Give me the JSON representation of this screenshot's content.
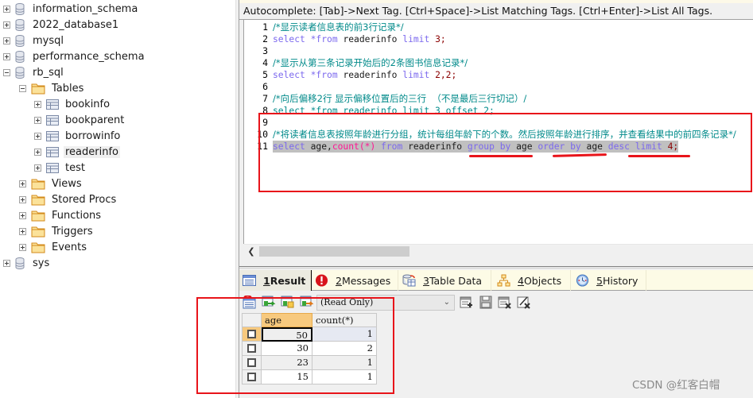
{
  "object_browser": {
    "databases": [
      {
        "name": "information_schema",
        "expanded": false
      },
      {
        "name": "2022_database1",
        "expanded": false
      },
      {
        "name": "mysql",
        "expanded": false
      },
      {
        "name": "performance_schema",
        "expanded": false
      },
      {
        "name": "rb_sql",
        "expanded": true
      },
      {
        "name": "sys",
        "expanded": false
      }
    ],
    "rb_sql_folders": {
      "tables_label": "Tables",
      "tables": [
        "bookinfo",
        "bookparent",
        "borrowinfo",
        "readerinfo",
        "test"
      ],
      "selected_table": "readerinfo",
      "other_folders": [
        "Views",
        "Stored Procs",
        "Functions",
        "Triggers",
        "Events"
      ]
    }
  },
  "editor": {
    "autocomplete_hint": "Autocomplete: [Tab]->Next Tag. [Ctrl+Space]->List Matching Tags. [Ctrl+Enter]->List All Tags.",
    "line_numbers": [
      "1",
      "2",
      "3",
      "4",
      "5",
      "6",
      "7",
      "8",
      "9",
      "10",
      "11"
    ],
    "lines": {
      "l1": "/*显示读者信息表的前3行记录*/",
      "l2_kw1": "select",
      "l2_rest1": " *",
      "l2_kw2": "from",
      "l2_id": " readerinfo ",
      "l2_kw3": "limit",
      "l2_num": " 3;",
      "l4": "/*显示从第三条记录开始后的2条图书信息记录*/",
      "l5_kw1": "select",
      "l5_rest1": " *",
      "l5_kw2": "from",
      "l5_id": " readerinfo ",
      "l5_kw3": "limit",
      "l5_num": " 2,2;",
      "l7": "/*向后偏移2行 显示偏移位置后的三行  （不是最后三行切记）/",
      "l8": "select *from readerinfo limit 3 offset 2;",
      "l10": "/*将读者信息表按照年龄进行分组，统计每组年龄下的个数。然后按照年龄进行排序，并查看结果中的前四条记录*/",
      "l11": {
        "t1": "select",
        "t2": " age,",
        "t3": "count",
        "t4": "(*)",
        "t5": " from",
        "t6": " readerinfo ",
        "t7": "group by",
        "t8": " age ",
        "t9": "order by",
        "t10": " age ",
        "t11": "desc limit",
        "t12": " 4;"
      }
    }
  },
  "result_tabs": [
    {
      "num": "1",
      "label": " Result",
      "active": true
    },
    {
      "num": "2",
      "label": " Messages",
      "active": false
    },
    {
      "num": "3",
      "label": " Table Data",
      "active": false
    },
    {
      "num": "4",
      "label": " Objects",
      "active": false
    },
    {
      "num": "5",
      "label": " History",
      "active": false
    }
  ],
  "result_toolbar": {
    "mode_select": "(Read Only)"
  },
  "result_grid": {
    "columns": [
      "age",
      "count(*)"
    ],
    "rows": [
      {
        "age": "50",
        "count": "1"
      },
      {
        "age": "30",
        "count": "2"
      },
      {
        "age": "23",
        "count": "1"
      },
      {
        "age": "15",
        "count": "1"
      }
    ]
  },
  "colors": {
    "annotation_red": "#e8141a",
    "keyword": "#7b68ee",
    "comment": "#008a8a",
    "function": "#ff1493",
    "header_active": "#f7c97e"
  },
  "watermark": "CSDN @红客白帽"
}
